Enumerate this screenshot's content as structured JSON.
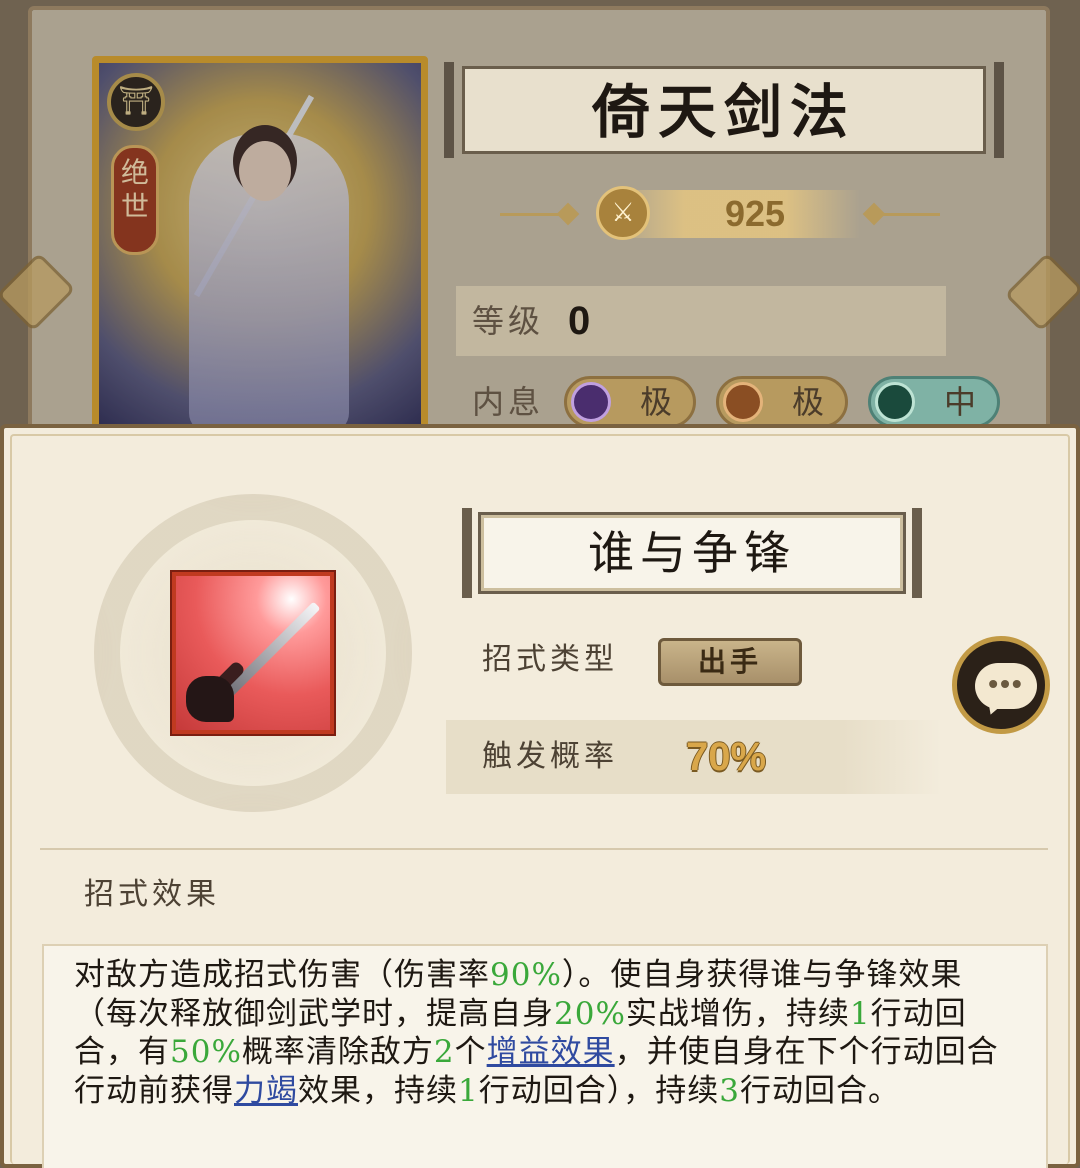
{
  "background": {
    "card": {
      "emblem": "⛩",
      "rank": "绝世"
    },
    "art_name": "倚天剑法",
    "power": "925",
    "level_label": "等级",
    "level_value": "0",
    "energy_label": "内息",
    "energy_levels": [
      "极",
      "极",
      "中"
    ]
  },
  "popup": {
    "skill_name": "谁与争锋",
    "type_label": "招式类型",
    "type_value": "出手",
    "chance_label": "触发概率",
    "chance_value": "70%",
    "chat_button": "•••",
    "effect_header": "招式效果",
    "description": {
      "p1": "对敌方造成招式伤害（伤害率",
      "v1": "90%",
      "p2": "）。使自身获得谁与争锋效果（每次释放御剑武学时，提高自身",
      "v2": "20%",
      "p3": "实战增伤，持续",
      "v3": "1",
      "p4": "行动回合，有",
      "v4": "50%",
      "p5": "概率清除敌方",
      "v5": "2",
      "p6": "个",
      "link1": "增益效果",
      "p7": "，并使自身在下个行动回合行动前获得",
      "link2": "力竭",
      "p8": "效果，持续",
      "v6": "1",
      "p9": "行动回合），持续",
      "v7": "3",
      "p10": "行动回合。"
    }
  },
  "colors": {
    "highlight_green": "#3aa83a",
    "link_blue": "#2f4aa0",
    "frame_brown": "#7a6240",
    "gold": "#c29a45"
  },
  "icons": {
    "skill": "sword-slash-icon",
    "chat": "chat-bubble-icon"
  }
}
